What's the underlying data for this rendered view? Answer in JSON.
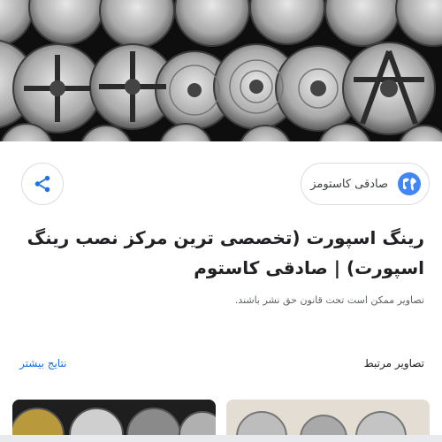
{
  "hero": {
    "alt_icon": "wheel-wall-image"
  },
  "share": {
    "icon": "share-icon"
  },
  "source": {
    "name": "صادقی کاستومز",
    "icon": "globe-icon",
    "icon_color": "#4285f4"
  },
  "title": "رینگ اسپورت (تخصصی ترین مرکز نصب رینگ اسپورت) | صادقی کاستوم",
  "notice": "تصاویر ممکن است تحت قانون حق نشر باشند.",
  "related": {
    "heading": "تصاویر مرتبط",
    "more_label": "نتایج بیشتر"
  },
  "colors": {
    "accent": "#1a73e8",
    "text": "#202124",
    "muted": "#5f6368"
  }
}
